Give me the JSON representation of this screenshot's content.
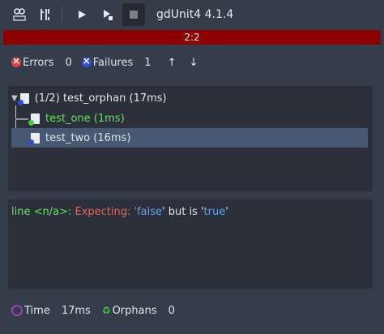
{
  "app": {
    "title": "gdUnit4 4.1.4"
  },
  "progress": {
    "text": "2:2",
    "color": "#8b0000"
  },
  "stats": {
    "errors_label": "Errors",
    "errors_count": "0",
    "failures_label": "Failures",
    "failures_count": "1",
    "prev_arrow": "↑",
    "next_arrow": "↓"
  },
  "tree": {
    "root": {
      "label": "(1/2) test_orphan (17ms)"
    },
    "children": [
      {
        "label": "test_one (1ms)",
        "status": "passed"
      },
      {
        "label": "test_two (16ms)",
        "status": "failed",
        "selected": true
      }
    ]
  },
  "output": {
    "prefix": "line <n/a>:",
    "message": " Expecting: '",
    "expected": "false",
    "middle": "' but is '",
    "actual": "true",
    "end": "'"
  },
  "footer": {
    "time_label": "Time",
    "time_value": "17ms",
    "orphans_label": "Orphans",
    "orphans_value": "0"
  },
  "colors": {
    "background": "#363d4a",
    "panel": "#2b303a",
    "selection": "#465872",
    "pass": "#5fe35f",
    "fail_text": "#e0665e",
    "value": "#5aa7f0"
  },
  "icons": [
    "doc-icon",
    "tools-icon",
    "play-icon",
    "debug-run-icon",
    "stop-icon",
    "error-icon",
    "failure-icon",
    "time-icon",
    "orphans-icon"
  ]
}
